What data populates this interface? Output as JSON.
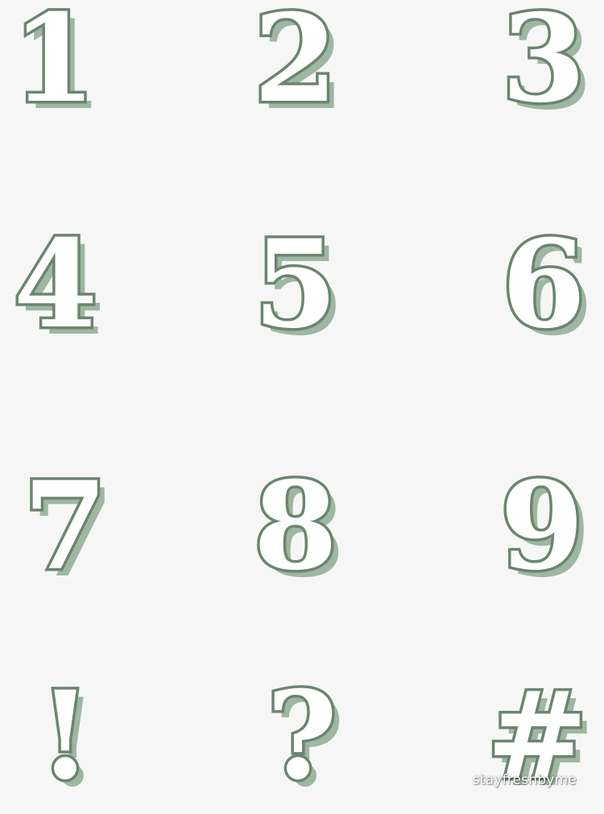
{
  "stickers": [
    {
      "name": "sticker-digit-1",
      "glyph": "1"
    },
    {
      "name": "sticker-digit-2",
      "glyph": "2"
    },
    {
      "name": "sticker-digit-3",
      "glyph": "3"
    },
    {
      "name": "sticker-digit-4",
      "glyph": "4"
    },
    {
      "name": "sticker-digit-5",
      "glyph": "5"
    },
    {
      "name": "sticker-digit-6",
      "glyph": "6"
    },
    {
      "name": "sticker-digit-7",
      "glyph": "7"
    },
    {
      "name": "sticker-digit-8",
      "glyph": "8"
    },
    {
      "name": "sticker-digit-9",
      "glyph": "9"
    },
    {
      "name": "sticker-exclamation",
      "glyph": "!"
    },
    {
      "name": "sticker-question",
      "glyph": "?"
    },
    {
      "name": "sticker-hash",
      "glyph": "#"
    }
  ],
  "watermark": "stayfreshbyme",
  "colors": {
    "background": "#f6f6f6",
    "outline": "#6b8570",
    "shadow": "#9fb7a2",
    "face": "#ffffff"
  }
}
